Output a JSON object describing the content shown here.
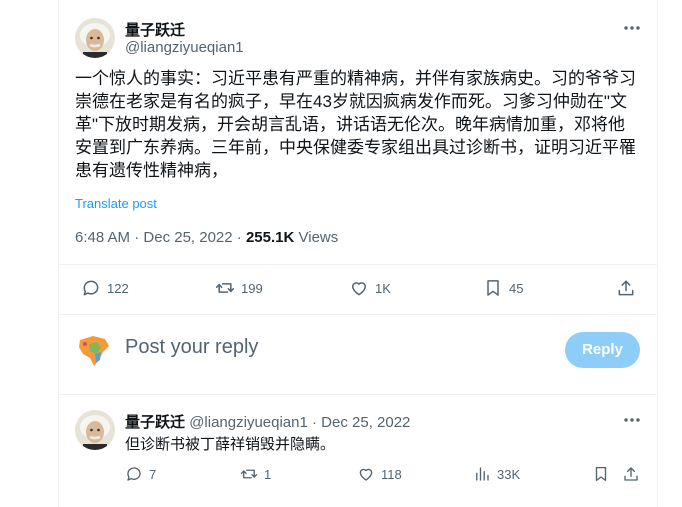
{
  "main_tweet": {
    "display_name": "量子跃迁",
    "handle": "@liangziyueqian1",
    "lines": [
      "一个惊人的事实：习近平患有严重的精神病，并伴有家族病史。习的爷爷习",
      "崇德在老家是有名的疯子，早在43岁就因疯病发作而死。习爹习仲勋在\"文",
      "革\"下放时期发病，开会胡言乱语，讲话语无伦次。晚年病情加重，邓将他",
      "安置到广东养病。三年前，中央保健委专家组出具过诊断书，证明习近平罹",
      "患有遗传性精神病，"
    ],
    "translate_label": "Translate post",
    "time": "6:48 AM",
    "date": "Dec 25, 2022",
    "views_count": "255.1K",
    "views_label": "Views",
    "stats": {
      "replies": "122",
      "reposts": "199",
      "likes": "1K",
      "bookmarks": "45"
    }
  },
  "reply_composer": {
    "placeholder": "Post your reply",
    "button_label": "Reply"
  },
  "reply_tweet": {
    "display_name": "量子跃迁",
    "handle": "@liangziyueqian1",
    "date": "Dec 25, 2022",
    "text": "但诊断书被丁薛祥销毁并隐瞒。",
    "stats": {
      "replies": "7",
      "reposts": "1",
      "likes": "118",
      "views": "33K"
    }
  },
  "icons": {
    "more": "more-dots-icon",
    "reply": "speech-bubble-icon",
    "repost": "repost-arrows-icon",
    "like": "heart-icon",
    "bookmark": "bookmark-icon",
    "share": "share-upload-icon",
    "views": "bar-chart-icon"
  },
  "colors": {
    "accent": "#1d9bf0",
    "reply_button_disabled": "#8ecdf8",
    "secondary_text": "#536471",
    "primary_text": "#0f1419"
  }
}
